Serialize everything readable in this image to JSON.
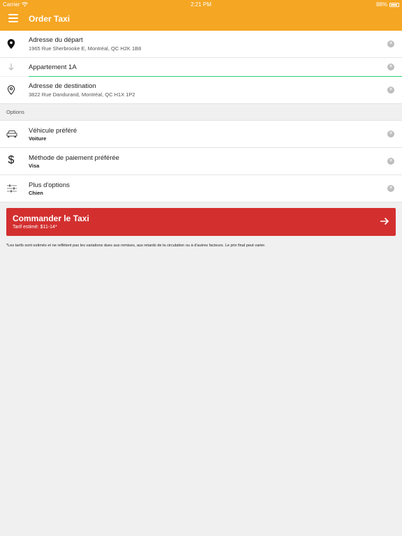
{
  "status_bar": {
    "carrier": "Carrier",
    "time": "2:21 PM",
    "battery": "88%"
  },
  "navbar": {
    "title": "Order Taxi"
  },
  "addresses": {
    "departure": {
      "title": "Adresse du départ",
      "value": "1965 Rue Sherbrooke E, Montréal, QC H2K 1B8"
    },
    "apartment": {
      "value": "Appartement 1A"
    },
    "destination": {
      "title": "Adresse de destination",
      "value": "3822 Rue Dandurand, Montréal, QC H1X 1P2"
    }
  },
  "options": {
    "section_label": "Options",
    "items": [
      {
        "title": "Véhicule préféré",
        "value": "Voiture",
        "icon": "car-icon"
      },
      {
        "title": "Méthode de paiement préférée",
        "value": "Visa",
        "icon": "dollar-icon"
      },
      {
        "title": "Plus d'options",
        "value": "Chien",
        "icon": "sliders-icon"
      }
    ]
  },
  "order": {
    "label": "Commander le Taxi",
    "fare": "Tarif estimé: $11-14*"
  },
  "disclaimer": "*Les tarifs sont estimés et ne reflètent pas les variations dues aux remises, aux retards de la circulation ou à d'autres facteurs. Le prix final peut varier.",
  "colors": {
    "accent": "#f5a623",
    "order_button": "#d32f2f",
    "focus_line": "#2ecc71"
  }
}
